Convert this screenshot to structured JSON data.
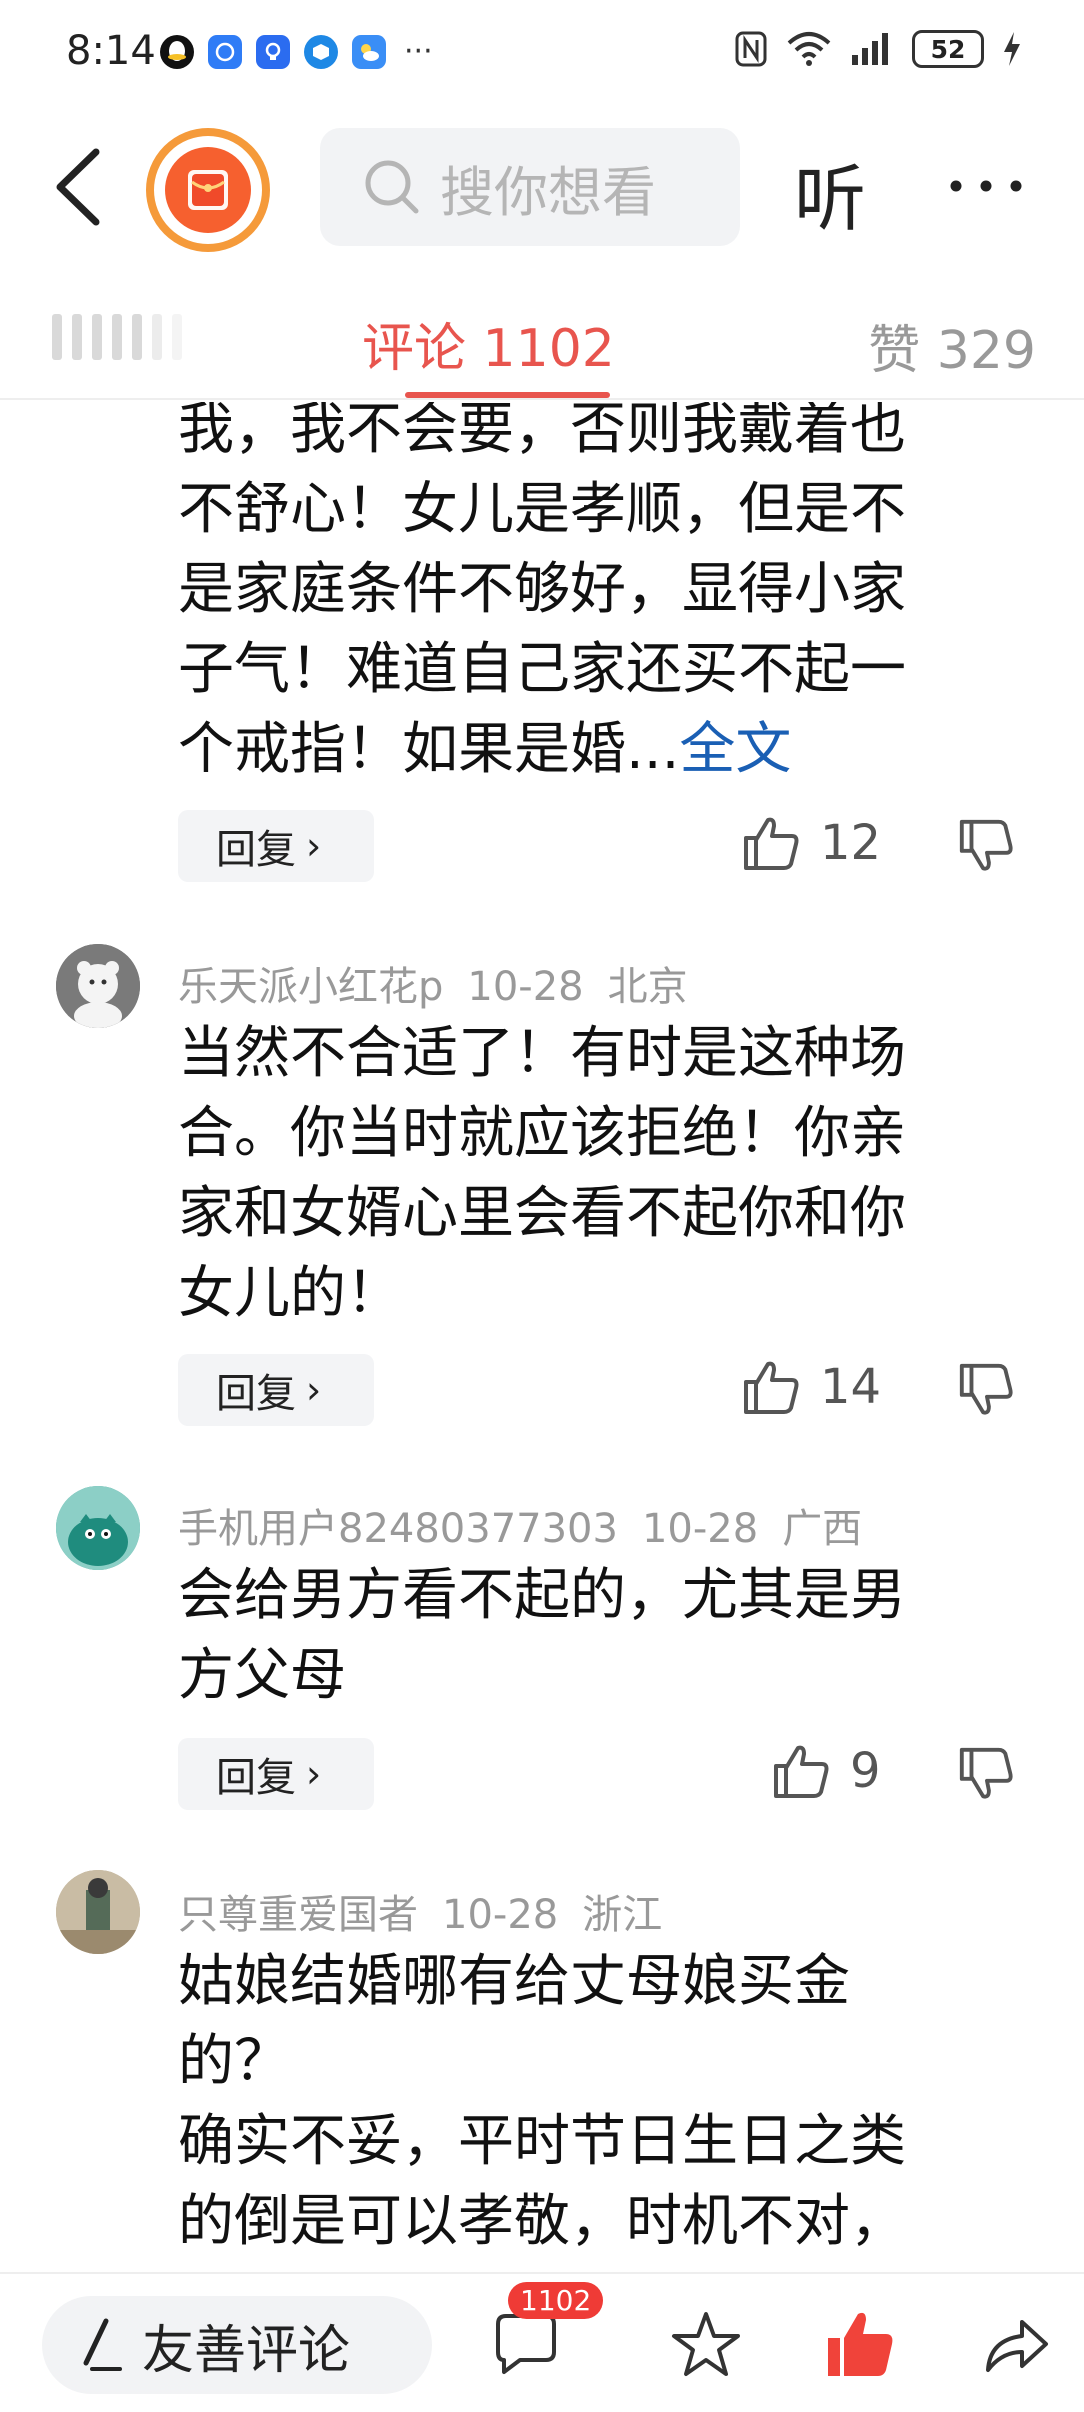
{
  "status_bar": {
    "time": "8:14",
    "more": "···",
    "battery": "52"
  },
  "header": {
    "search_placeholder": "搜你想看",
    "listen_label": "听",
    "more_label": "···"
  },
  "tabs": {
    "comments_label": "评论",
    "comments_count": "1102",
    "likes_label": "赞",
    "likes_count": "329"
  },
  "comments": [
    {
      "partial": true,
      "lines": [
        "我，我不会要，否则我戴着也",
        "不舒心！女儿是孝顺，但是不",
        "是家庭条件不够好，显得小家",
        "子气！难道自己家还买不起一"
      ],
      "last_line": "个戒指！如果是婚...",
      "fulltext_label": "全文",
      "reply_label": "回复",
      "likes": "12"
    },
    {
      "author": "乐天派小红花p",
      "date": "10-28",
      "location": "北京",
      "lines": [
        "当然不合适了！有时是这种场",
        "合。你当时就应该拒绝！你亲",
        "家和女婿心里会看不起你和你",
        "女儿的！"
      ],
      "reply_label": "回复",
      "likes": "14"
    },
    {
      "author": "手机用户82480377303",
      "date": "10-28",
      "location": "广西",
      "lines": [
        "会给男方看不起的，尤其是男",
        "方父母"
      ],
      "reply_label": "回复",
      "likes": "9"
    },
    {
      "author": "只尊重爱国者",
      "date": "10-28",
      "location": "浙江",
      "lines": [
        "姑娘结婚哪有给丈母娘买金",
        "的？",
        "确实不妥，平时节日生日之类",
        "的倒是可以孝敬，时机不对，"
      ]
    }
  ],
  "bottom_bar": {
    "comment_input_label": "友善评论",
    "comment_badge": "1102"
  },
  "colors": {
    "accent_red": "#e8554e",
    "link_blue": "#1a5fb4",
    "like_red": "#f0433a"
  }
}
